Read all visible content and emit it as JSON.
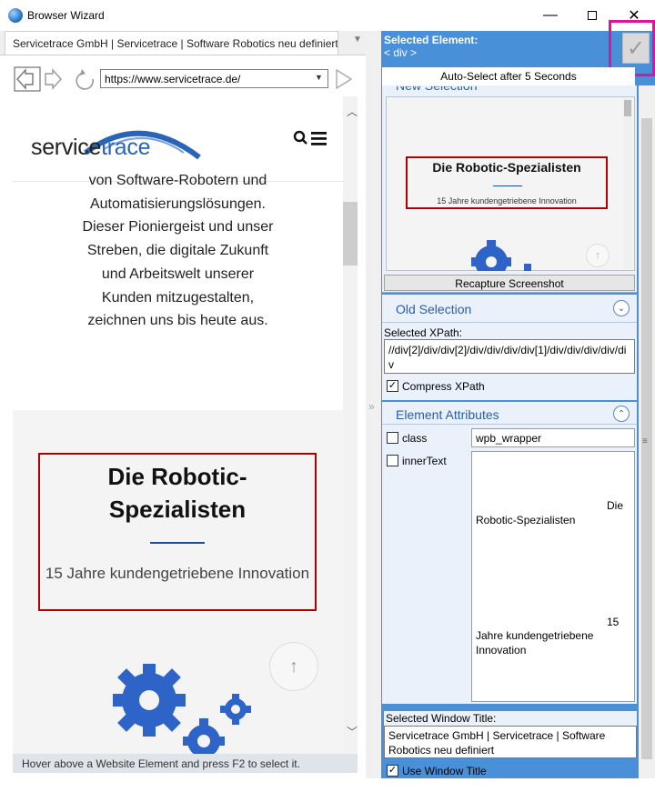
{
  "window": {
    "title": "Browser Wizard",
    "minimize": "—",
    "maximize": "☐",
    "close": "✕"
  },
  "browser": {
    "tab_label": "Servicetrace GmbH | Servicetrace | Software Robotics neu definiert",
    "url": "https://www.servicetrace.de/",
    "status": "Hover above a Website Element and press F2 to select it."
  },
  "webpage": {
    "logo_service": "service",
    "logo_trace": "trace",
    "body_lines": [
      "von Software-Robotern und",
      "Automatisierungslösungen.",
      "Dieser Pioniergeist und unser",
      "Streben, die digitale Zukunft",
      "und Arbeitswelt unserer",
      "Kunden mitzugestalten,",
      "zeichnen uns bis heute aus."
    ],
    "robotic_title": "Die Robotic-Spezialisten",
    "robotic_sub": "15 Jahre kundengetriebene Innovation"
  },
  "panel": {
    "selected_element_label": "Selected Element:",
    "selected_element_value": "< div >",
    "auto_select": "Auto-Select after 5 Seconds",
    "new_selection_title": "New Selection",
    "recapture": "Recapture Screenshot",
    "old_selection_title": "Old Selection",
    "xpath_label": "Selected XPath:",
    "xpath_value": "//div[2]/div/div[2]/div/div/div/div[1]/div/div/div/div/div",
    "compress_xpath": "Compress XPath",
    "attributes_title": "Element Attributes",
    "attr_class_label": "class",
    "attr_class_value": "wpb_wrapper",
    "attr_inner_label": "innerText",
    "inner_die": "Die",
    "inner_robotic": "Robotic-Spezialisten",
    "inner_15": "15",
    "inner_jahre": "Jahre kundengetriebene",
    "inner_innovation": "Innovation",
    "window_title_label": "Selected Window Title:",
    "window_title_value": "Servicetrace GmbH | Servicetrace | Software Robotics neu definiert",
    "use_window_title": "Use Window Title"
  },
  "colors": {
    "panel_blue": "#4a90d9",
    "highlight_magenta": "#e0139b",
    "selection_red": "#b00000",
    "brand_blue": "#2864b8"
  }
}
